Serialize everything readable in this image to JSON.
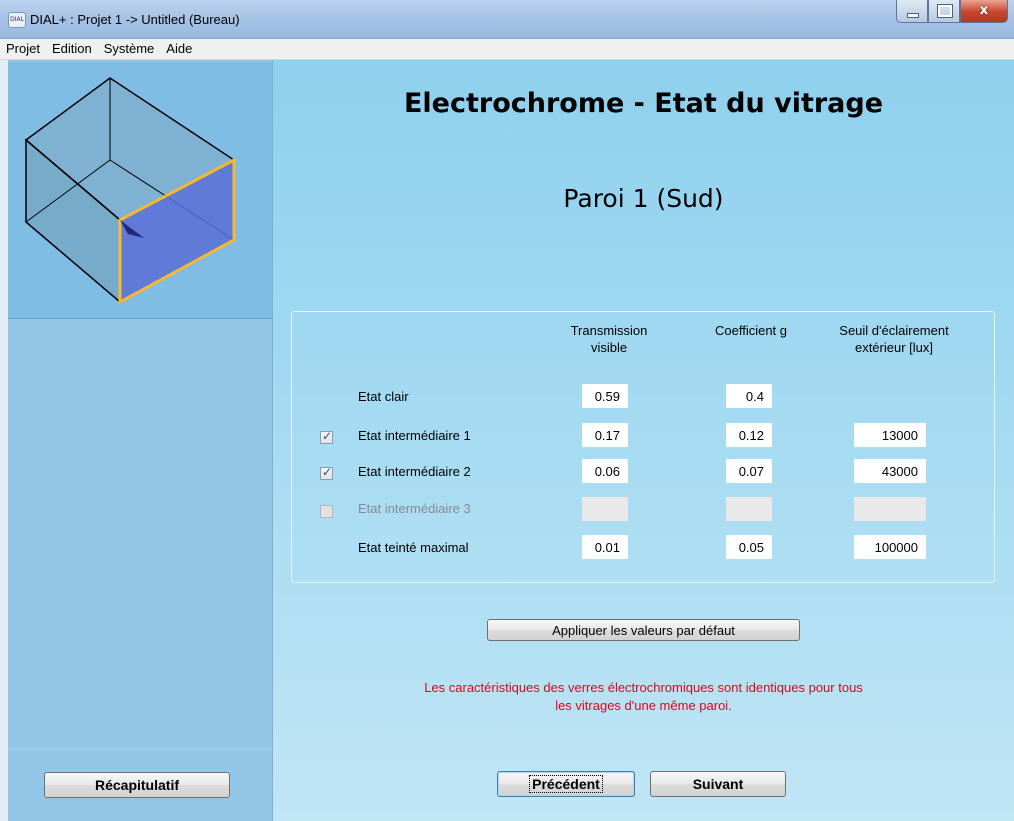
{
  "window": {
    "app_icon_text": "DIAL",
    "title": "DIAL+ : Projet 1 -> Untitled (Bureau)",
    "close_glyph": "x"
  },
  "menu": [
    "Projet",
    "Edition",
    "Système",
    "Aide"
  ],
  "sidebar": {
    "summary_button": "Récapitulatif"
  },
  "main": {
    "title": "Electrochrome - Etat du vitrage",
    "subtitle": "Paroi 1 (Sud)",
    "columns": {
      "transmission": [
        "Transmission",
        "visible"
      ],
      "coefficient": "Coefficient g",
      "threshold": [
        "Seuil d'éclairement",
        "extérieur [lux]"
      ]
    },
    "rows": [
      {
        "label": "Etat clair",
        "has_checkbox": false,
        "checked": false,
        "enabled": true,
        "transmission": "0.59",
        "coefficient": "0.4",
        "threshold": ""
      },
      {
        "label": "Etat intermédiaire 1",
        "has_checkbox": true,
        "checked": true,
        "enabled": true,
        "transmission": "0.17",
        "coefficient": "0.12",
        "threshold": "13000"
      },
      {
        "label": "Etat intermédiaire 2",
        "has_checkbox": true,
        "checked": true,
        "enabled": true,
        "transmission": "0.06",
        "coefficient": "0.07",
        "threshold": "43000"
      },
      {
        "label": "Etat intermédiaire 3",
        "has_checkbox": true,
        "checked": false,
        "enabled": false,
        "transmission": "",
        "coefficient": "",
        "threshold": ""
      },
      {
        "label": "Etat teinté maximal",
        "has_checkbox": false,
        "checked": false,
        "enabled": true,
        "transmission": "0.01",
        "coefficient": "0.05",
        "threshold": "100000"
      }
    ],
    "apply_defaults_button": "Appliquer les valeurs par défaut",
    "note": [
      "Les caractéristiques des verres électrochromiques sont identiques pour tous",
      "les vitrages d'une même paroi."
    ],
    "prev_button": "Précédent",
    "next_button": "Suivant"
  },
  "colors": {
    "sidebar_bg": "#92c6e6",
    "main_bg": "#a6dbf2",
    "note_text": "#e8001a",
    "wall_highlight": "#f5b82e",
    "glazing_fill": "#5a6fd6"
  }
}
